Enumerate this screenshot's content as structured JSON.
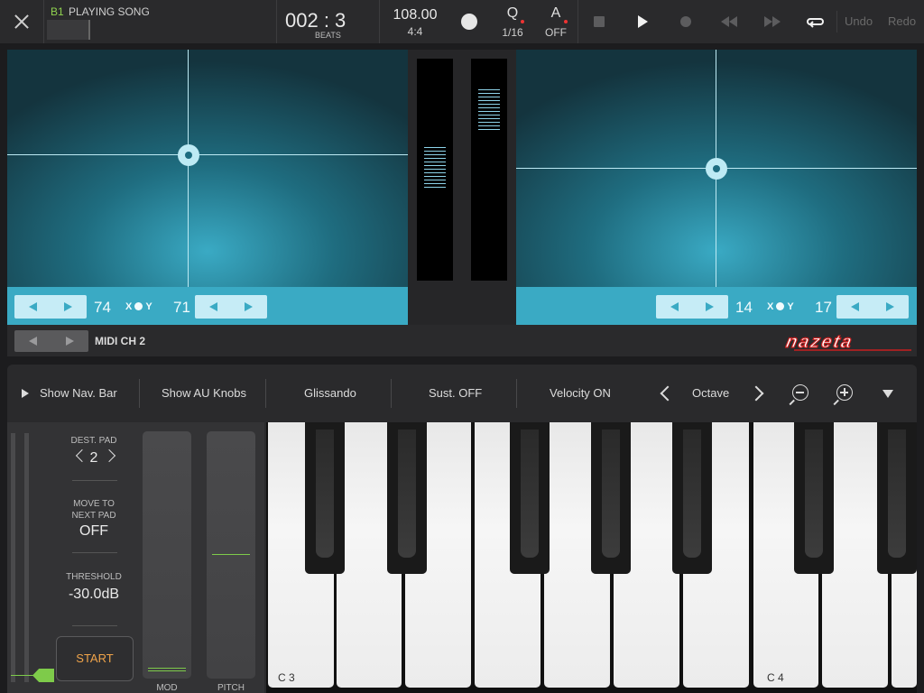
{
  "topbar": {
    "song_id": "B1",
    "song_title": "PLAYING SONG",
    "position": "002 : 3",
    "position_label": "BEATS",
    "tempo": "108.00",
    "time_signature": "4:4",
    "quantize_label": "Q",
    "quantize_value": "1/16",
    "auto_label": "A",
    "auto_value": "OFF",
    "undo_label": "Undo",
    "redo_label": "Redo"
  },
  "xy": {
    "left_x_value": "74",
    "left_y_value": "71",
    "right_x_value": "14",
    "right_y_value": "17",
    "x_label": "X",
    "y_label": "Y"
  },
  "midi": {
    "channel_label": "MIDI CH 2",
    "logo_text": "nazeta"
  },
  "keyboard_bar": {
    "show_nav_bar": "Show Nav. Bar",
    "show_au_knobs": "Show AU Knobs",
    "glissando": "Glissando",
    "sustain": "Sust. OFF",
    "velocity": "Velocity ON",
    "octave": "Octave"
  },
  "left_panel": {
    "dest_pad_label": "DEST. PAD",
    "dest_pad_value": "2",
    "move_to_line1": "MOVE TO",
    "move_to_line2": "NEXT PAD",
    "move_to_value": "OFF",
    "threshold_label": "THRESHOLD",
    "threshold_value": "-30.0dB",
    "start_label": "START",
    "mod_label": "MOD",
    "pitch_label": "PITCH"
  },
  "keys": {
    "label_c3": "C 3",
    "label_c4": "C 4"
  },
  "colors": {
    "accent": "#3aaac4",
    "green": "#7ecb4a",
    "orange": "#f0a44a",
    "logo_red": "#c81e1e"
  }
}
